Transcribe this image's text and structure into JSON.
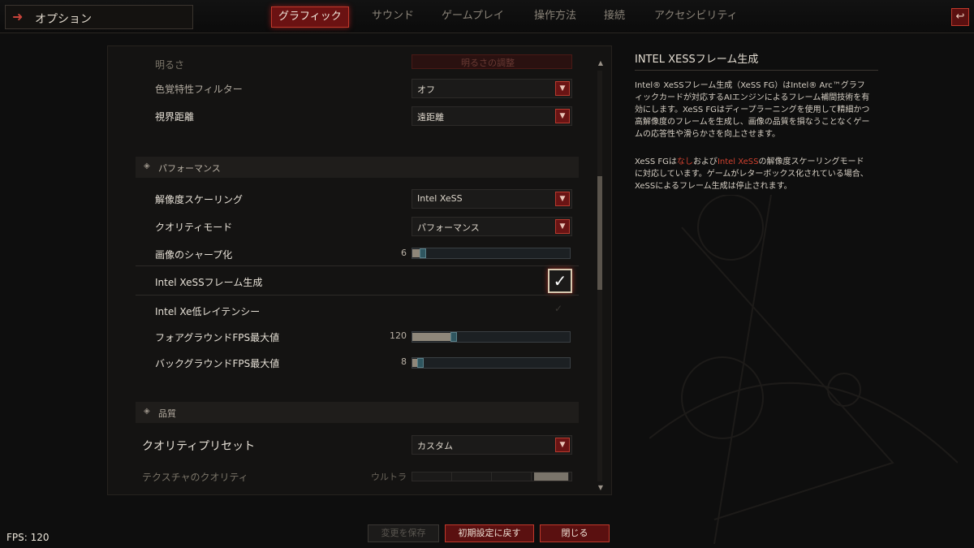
{
  "header": {
    "title": "オプション",
    "tabs": [
      {
        "label": "グラフィック",
        "active": true
      },
      {
        "label": "サウンド",
        "active": false
      },
      {
        "label": "ゲームプレイ",
        "active": false
      },
      {
        "label": "操作方法",
        "active": false
      },
      {
        "label": "接続",
        "active": false
      },
      {
        "label": "アクセシビリティ",
        "active": false
      }
    ]
  },
  "settings": {
    "faded_top_label": "明るさ",
    "faded_top_button": "明るさの調整",
    "color_filter": {
      "label": "色覚特性フィルター",
      "value": "オフ"
    },
    "view_distance": {
      "label": "視界距離",
      "value": "遠距離"
    },
    "performance_header": "パフォーマンス",
    "resolution_scaling": {
      "label": "解像度スケーリング",
      "value": "Intel XeSS"
    },
    "quality_mode": {
      "label": "クオリティモード",
      "value": "パフォーマンス"
    },
    "sharpening": {
      "label": "画像のシャープ化",
      "value": "6",
      "fraction": 0.05
    },
    "frame_gen": {
      "label": "Intel XeSSフレーム生成",
      "checked": true
    },
    "low_latency": {
      "label": "Intel Xe低レイテンシー"
    },
    "fg_fps": {
      "label": "フォアグラウンドFPS最大値",
      "value": "120",
      "fraction": 0.25
    },
    "bg_fps": {
      "label": "バックグラウンドFPS最大値",
      "value": "8",
      "fraction": 0.03
    },
    "quality_header": "品質",
    "quality_preset": {
      "label": "クオリティプリセット",
      "value": "カスタム"
    },
    "texture_quality": {
      "label": "テクスチャのクオリティ",
      "value": "ウルトラ"
    }
  },
  "info": {
    "title": "INTEL XESSフレーム生成",
    "para1": "Intel® XeSSフレーム生成（XeSS FG）はIntel® Arc™グラフィックカードが対応するAIエンジンによるフレーム補間技術を有効にします。XeSS FGはディープラーニングを使用して精細かつ高解像度のフレームを生成し、画像の品質を損なうことなくゲームの応答性や滑らかさを向上させます。",
    "para2_a": "XeSS FGは",
    "para2_b": "なし",
    "para2_c": "および",
    "para2_d": "Intel XeSS",
    "para2_e": "の解像度スケーリングモードに対応しています。ゲームがレターボックス化されている場合、XeSSによるフレーム生成は停止されます。"
  },
  "footer": {
    "save": "変更を保存",
    "reset": "初期設定に戻す",
    "close": "閉じる"
  },
  "fps_label": "FPS: 120",
  "colors": {
    "accent": "#c0392b",
    "highlight": "#d0412f",
    "background": "#0e0e0e"
  }
}
